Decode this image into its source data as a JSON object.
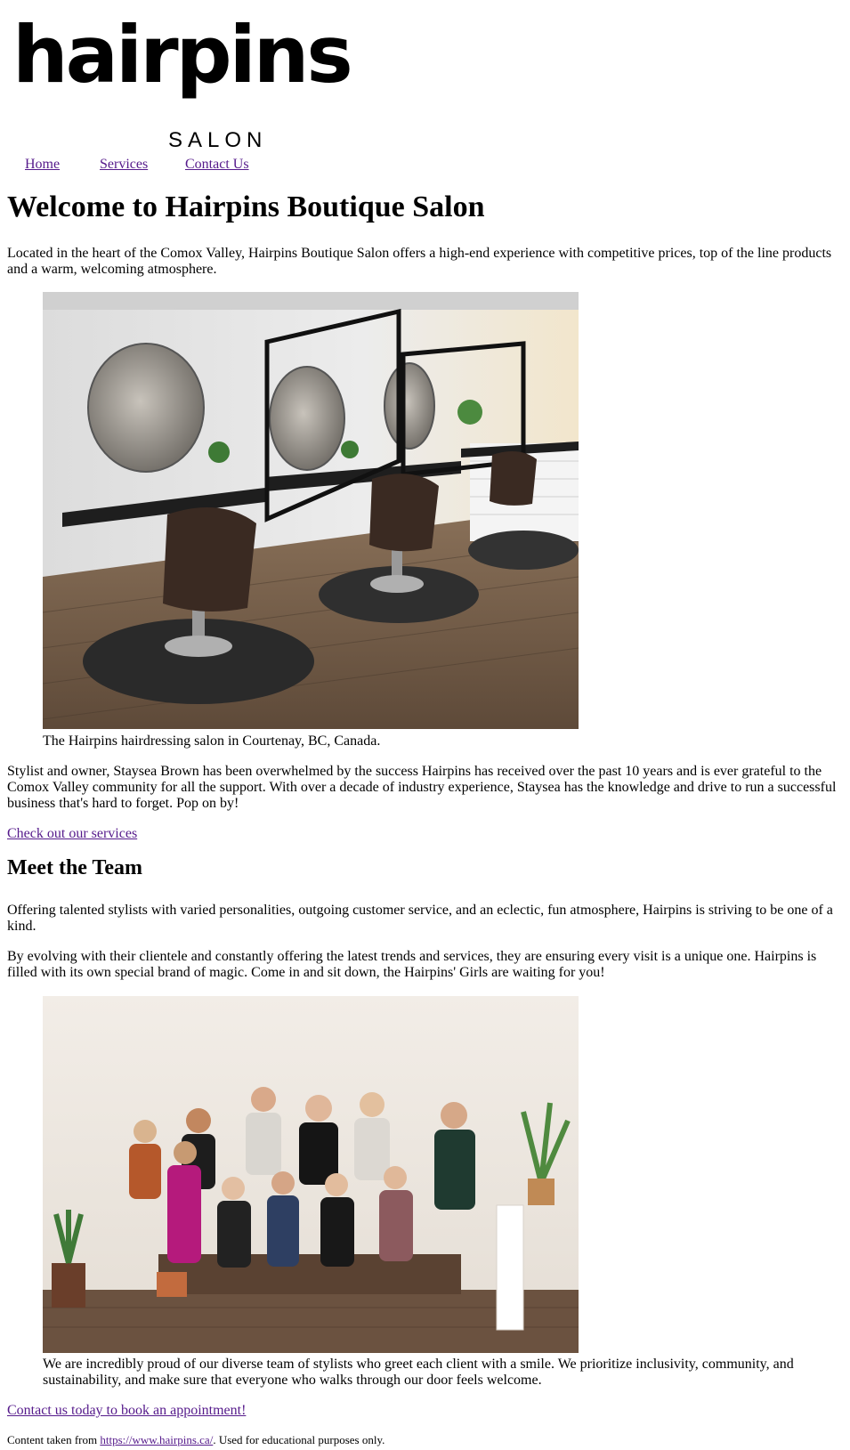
{
  "logo": {
    "word": "hairpins",
    "sub": "SALON"
  },
  "nav": {
    "home": "Home",
    "services": "Services",
    "contact": "Contact Us"
  },
  "heading": "Welcome to Hairpins Boutique Salon",
  "intro": "Located in the heart of the Comox Valley, Hairpins Boutique Salon offers a high-end experience with competitive prices, top of the line products and a warm, welcoming atmosphere.",
  "salon_caption": "The Hairpins hairdressing salon in Courtenay, BC, Canada.",
  "owner_text": "Stylist and owner, Staysea Brown has been overwhelmed by the success Hairpins has received over the past 10 years and is ever grateful to the Comox Valley community for all the support. With over a decade of industry experience, Staysea has the knowledge and drive to run a successful business that's hard to forget. Pop on by!",
  "services_link": "Check out our services",
  "team_heading": "Meet the Team",
  "team_p1": "Offering talented stylists with varied personalities, outgoing customer service, and an eclectic, fun atmosphere, Hairpins is striving to be one of a kind.",
  "team_p2": "By evolving with their clientele and constantly offering the latest trends and services, they are ensuring every visit is a unique one. Hairpins is filled with its own special brand of magic. Come in and sit down, the Hairpins' Girls are waiting for you!",
  "team_caption": "We are incredibly proud of our diverse team of stylists who greet each client with a smile. We prioritize inclusivity, community, and sustainability, and make sure that everyone who walks through our door feels welcome.",
  "book_link": "Contact us today to book an appointment!",
  "footer": {
    "prefix": "Content taken from ",
    "link": "https://www.hairpins.ca/",
    "suffix": ". Used for educational purposes only."
  },
  "colors": {
    "link": "#551a8b",
    "text": "#000000",
    "background": "#ffffff"
  }
}
